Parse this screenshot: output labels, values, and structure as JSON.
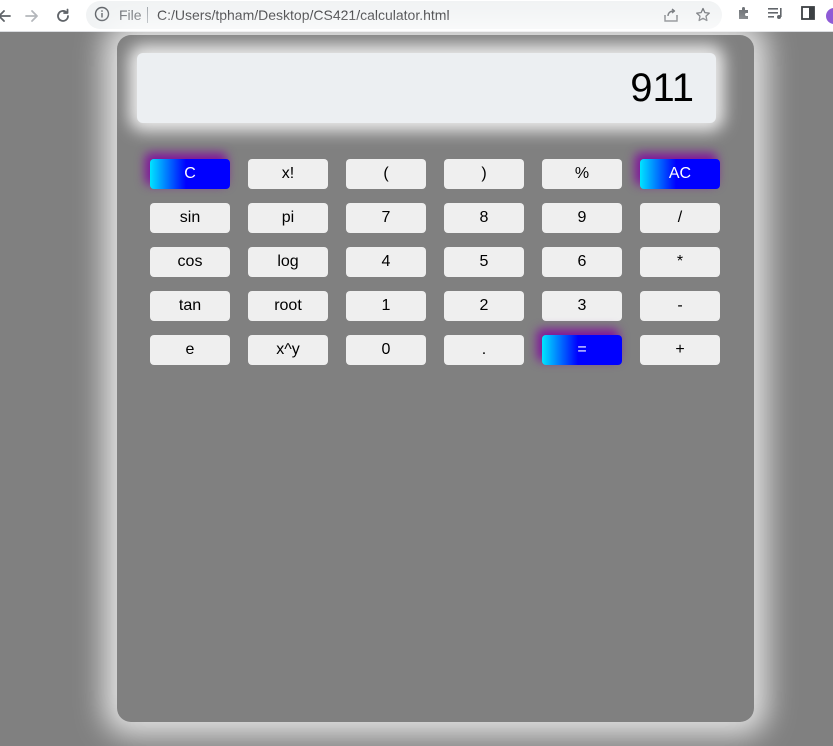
{
  "browser": {
    "file_label": "File",
    "url": "C:/Users/tpham/Desktop/CS421/calculator.html"
  },
  "calculator": {
    "display_value": "911",
    "keys": [
      {
        "label": "C",
        "name": "clear-button",
        "accent": true
      },
      {
        "label": "x!",
        "name": "factorial-button",
        "accent": false
      },
      {
        "label": "(",
        "name": "open-paren-button",
        "accent": false
      },
      {
        "label": ")",
        "name": "close-paren-button",
        "accent": false
      },
      {
        "label": "%",
        "name": "percent-button",
        "accent": false
      },
      {
        "label": "AC",
        "name": "all-clear-button",
        "accent": true
      },
      {
        "label": "sin",
        "name": "sin-button",
        "accent": false
      },
      {
        "label": "pi",
        "name": "pi-button",
        "accent": false
      },
      {
        "label": "7",
        "name": "digit-7-button",
        "accent": false
      },
      {
        "label": "8",
        "name": "digit-8-button",
        "accent": false
      },
      {
        "label": "9",
        "name": "digit-9-button",
        "accent": false
      },
      {
        "label": "/",
        "name": "divide-button",
        "accent": false
      },
      {
        "label": "cos",
        "name": "cos-button",
        "accent": false
      },
      {
        "label": "log",
        "name": "log-button",
        "accent": false
      },
      {
        "label": "4",
        "name": "digit-4-button",
        "accent": false
      },
      {
        "label": "5",
        "name": "digit-5-button",
        "accent": false
      },
      {
        "label": "6",
        "name": "digit-6-button",
        "accent": false
      },
      {
        "label": "*",
        "name": "multiply-button",
        "accent": false
      },
      {
        "label": "tan",
        "name": "tan-button",
        "accent": false
      },
      {
        "label": "root",
        "name": "root-button",
        "accent": false
      },
      {
        "label": "1",
        "name": "digit-1-button",
        "accent": false
      },
      {
        "label": "2",
        "name": "digit-2-button",
        "accent": false
      },
      {
        "label": "3",
        "name": "digit-3-button",
        "accent": false
      },
      {
        "label": "-",
        "name": "subtract-button",
        "accent": false
      },
      {
        "label": "e",
        "name": "euler-button",
        "accent": false
      },
      {
        "label": "x^y",
        "name": "power-button",
        "accent": false
      },
      {
        "label": "0",
        "name": "digit-0-button",
        "accent": false
      },
      {
        "label": ".",
        "name": "decimal-button",
        "accent": false
      },
      {
        "label": "=",
        "name": "equals-button",
        "accent": true
      },
      {
        "label": "+",
        "name": "add-button",
        "accent": false
      }
    ]
  },
  "colors": {
    "page_background": "#808080",
    "display_background": "#eceff2",
    "key_background": "#efefef",
    "accent_start": "#00e5ff",
    "accent_end": "#0000ff",
    "accent_glow": "#8000a0"
  },
  "icons": {
    "back": "arrow-left-icon",
    "forward": "arrow-right-icon",
    "reload": "reload-icon",
    "site_info": "info-icon",
    "share": "share-icon",
    "bookmark": "star-icon",
    "extensions": "puzzle-icon",
    "media": "media-queue-icon",
    "side_panel": "side-panel-icon",
    "profile": "avatar"
  }
}
